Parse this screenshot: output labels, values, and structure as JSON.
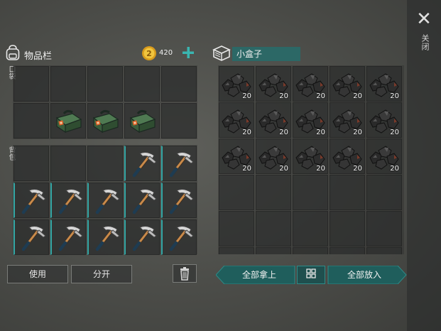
{
  "close": {
    "label": "关闭"
  },
  "inventory": {
    "title": "物品栏",
    "coins": "420",
    "pocket_label": "口袋",
    "backpack_label": "背包",
    "pocket_slots": [
      {
        "item": null
      },
      {
        "item": null
      },
      {
        "item": null
      },
      {
        "item": null
      },
      {
        "item": null
      },
      {
        "item": null
      },
      {
        "item": "toolbox"
      },
      {
        "item": "toolbox"
      },
      {
        "item": "toolbox"
      },
      {
        "item": null
      }
    ],
    "backpack_slots": [
      {
        "item": null
      },
      {
        "item": null
      },
      {
        "item": null
      },
      {
        "item": "pickaxe"
      },
      {
        "item": "pickaxe"
      },
      {
        "item": "pickaxe"
      },
      {
        "item": "pickaxe"
      },
      {
        "item": "pickaxe"
      },
      {
        "item": "pickaxe"
      },
      {
        "item": "pickaxe"
      },
      {
        "item": "pickaxe"
      },
      {
        "item": "pickaxe"
      },
      {
        "item": "pickaxe"
      },
      {
        "item": "pickaxe"
      },
      {
        "item": "pickaxe"
      }
    ]
  },
  "container": {
    "name": "小盒子",
    "slots": [
      {
        "item": "coal",
        "qty": "20"
      },
      {
        "item": "coal",
        "qty": "20"
      },
      {
        "item": "coal",
        "qty": "20"
      },
      {
        "item": "coal",
        "qty": "20"
      },
      {
        "item": "coal",
        "qty": "20"
      },
      {
        "item": "coal",
        "qty": "20"
      },
      {
        "item": "coal",
        "qty": "20"
      },
      {
        "item": "coal",
        "qty": "20"
      },
      {
        "item": "coal",
        "qty": "20"
      },
      {
        "item": "coal",
        "qty": "20"
      },
      {
        "item": "coal",
        "qty": "20"
      },
      {
        "item": "coal",
        "qty": "20"
      },
      {
        "item": "coal",
        "qty": "20"
      },
      {
        "item": "coal",
        "qty": "20"
      },
      {
        "item": "coal",
        "qty": "20"
      },
      {
        "item": null
      },
      {
        "item": null
      },
      {
        "item": null
      },
      {
        "item": null
      },
      {
        "item": null
      },
      {
        "item": null
      },
      {
        "item": null
      },
      {
        "item": null
      },
      {
        "item": null
      },
      {
        "item": null
      },
      {
        "item": null
      },
      {
        "item": null
      },
      {
        "item": null
      },
      {
        "item": null
      },
      {
        "item": null
      }
    ]
  },
  "actions": {
    "use": "使用",
    "split": "分开",
    "take_all": "全部拿上",
    "put_all": "全部放入"
  },
  "colors": {
    "accent": "#2c6866",
    "teal_button": "#1f5e5c",
    "coin": "#e0a92a"
  },
  "icons": [
    "backpack-icon",
    "coin-icon",
    "plus-icon",
    "close-icon",
    "box-icon",
    "trash-icon",
    "sort-icon",
    "pickaxe-icon",
    "toolbox-icon",
    "coal-icon"
  ]
}
